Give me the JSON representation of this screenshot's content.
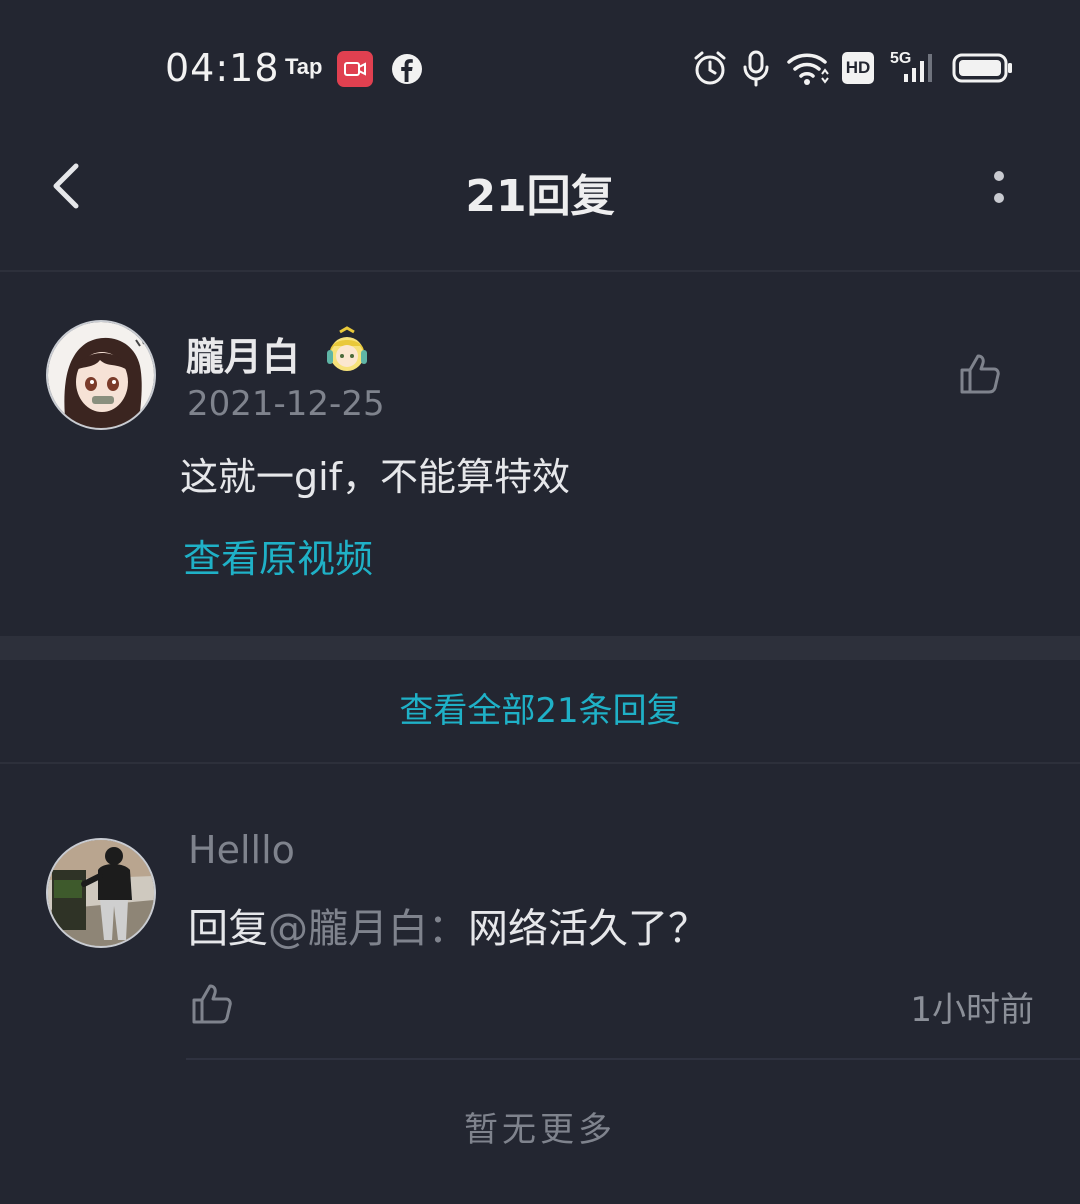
{
  "status_bar": {
    "time": "04:18",
    "app_icons": [
      "tap-app-icon",
      "video-record-icon",
      "facebook-icon"
    ],
    "tap_label": "Tap",
    "indicators": [
      "alarm-icon",
      "mic-icon",
      "wifi-icon",
      "hd-icon",
      "signal-5g-icon",
      "battery-icon"
    ],
    "hd_label": "HD",
    "network_label": "5G"
  },
  "header": {
    "title": "21回复",
    "back_icon": "chevron-left-icon",
    "more_icon": "more-vertical-icon"
  },
  "main_comment": {
    "username": "朧月白",
    "date": "2021-12-25",
    "text": "这就一gif，不能算特效",
    "view_video_label": "查看原视频",
    "like_icon": "thumbs-up-icon"
  },
  "view_all_label": "查看全部21条回复",
  "reply": {
    "username": "Helllo",
    "prefix": "回复",
    "mention": "@朧月白：",
    "body": "网络活久了？",
    "time": "1小时前",
    "like_icon": "thumbs-up-icon"
  },
  "footer": {
    "no_more_label": "暂无更多"
  },
  "colors": {
    "background": "#232631",
    "accent": "#1fb1c7",
    "muted": "#7f838d",
    "divider": "#2d303b"
  }
}
